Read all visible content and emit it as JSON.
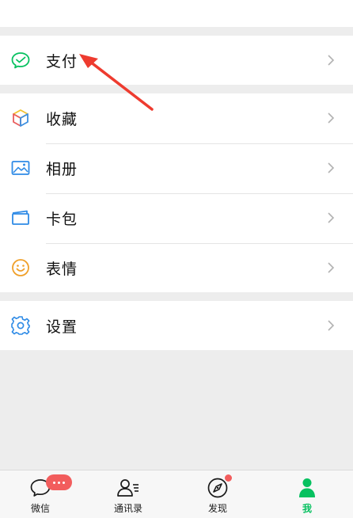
{
  "menu": {
    "pay_label": "支付",
    "favorites_label": "收藏",
    "album_label": "相册",
    "cards_label": "卡包",
    "stickers_label": "表情",
    "settings_label": "设置"
  },
  "tabbar": {
    "chats_label": "微信",
    "contacts_label": "通讯录",
    "discover_label": "发现",
    "me_label": "我",
    "active_tab": "我",
    "chats_badge": "more-dots",
    "discover_badge": "red-dot"
  },
  "colors": {
    "wechat_green": "#07c160",
    "badge_red": "#f25d5d",
    "annotation_arrow": "#ee3b2f",
    "background": "#ededed"
  },
  "icons": {
    "pay": "wechat-pay-icon",
    "favorites": "cube-icon",
    "album": "picture-icon",
    "cards": "wallet-icon",
    "stickers": "smiley-icon",
    "settings": "gear-icon",
    "chevron": "chevron-right-icon"
  }
}
